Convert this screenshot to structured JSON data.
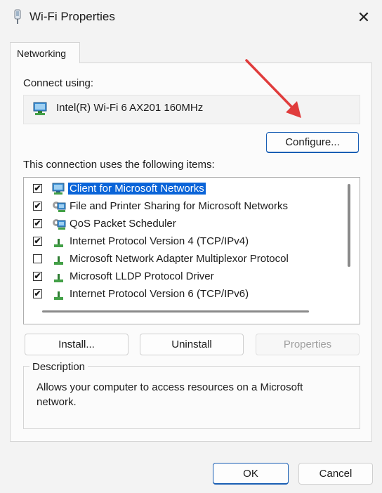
{
  "window": {
    "title": "Wi-Fi Properties",
    "close": "✕"
  },
  "tabs": [
    {
      "label": "Networking"
    }
  ],
  "connect": {
    "label": "Connect using:",
    "adapter": "Intel(R) Wi-Fi 6 AX201 160MHz",
    "configure": "Configure..."
  },
  "items": {
    "label": "This connection uses the following items:",
    "list": [
      {
        "label": "Client for Microsoft Networks",
        "checked": "✔",
        "icon": "network-client-icon"
      },
      {
        "label": "File and Printer Sharing for Microsoft Networks",
        "checked": "✔",
        "icon": "network-service-icon"
      },
      {
        "label": "QoS Packet Scheduler",
        "checked": "✔",
        "icon": "network-service-icon"
      },
      {
        "label": "Internet Protocol Version 4 (TCP/IPv4)",
        "checked": "✔",
        "icon": "protocol-icon"
      },
      {
        "label": "Microsoft Network Adapter Multiplexor Protocol",
        "checked": "",
        "icon": "protocol-icon"
      },
      {
        "label": "Microsoft LLDP Protocol Driver",
        "checked": "✔",
        "icon": "protocol-icon"
      },
      {
        "label": "Internet Protocol Version 6 (TCP/IPv6)",
        "checked": "✔",
        "icon": "protocol-icon"
      }
    ]
  },
  "buttons": {
    "install": "Install...",
    "uninstall": "Uninstall",
    "properties": "Properties",
    "ok": "OK",
    "cancel": "Cancel"
  },
  "description": {
    "title": "Description",
    "text": "Allows your computer to access resources on a Microsoft network."
  },
  "colors": {
    "selection": "#0a64d8",
    "accent": "#1a5fb4",
    "annotation_arrow": "#e03c3c"
  }
}
